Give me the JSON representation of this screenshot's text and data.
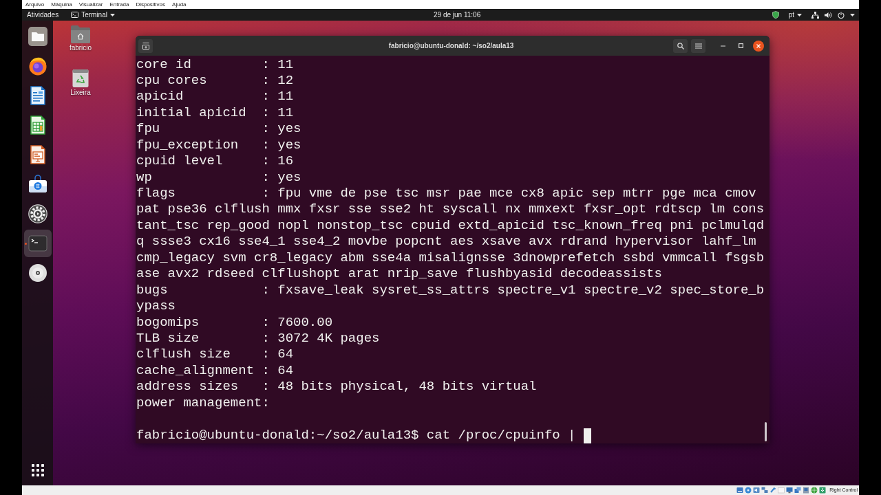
{
  "vm_menu": {
    "items": [
      "Arquivo",
      "Máquina",
      "Visualizar",
      "Entrada",
      "Dispositivos",
      "Ajuda"
    ]
  },
  "top_bar": {
    "activities": "Atividades",
    "app_menu": "Terminal",
    "clock": "29 de jun 11:06",
    "keyboard_layout": "pt"
  },
  "dock": {
    "items": [
      {
        "kind": "files",
        "selected": false,
        "running": false
      },
      {
        "kind": "browser",
        "selected": false,
        "running": false
      },
      {
        "kind": "writer",
        "selected": false,
        "running": false
      },
      {
        "kind": "spreadsheet",
        "selected": false,
        "running": false
      },
      {
        "kind": "presentation",
        "selected": false,
        "running": false
      },
      {
        "kind": "store",
        "selected": false,
        "running": false
      },
      {
        "kind": "settings",
        "selected": false,
        "running": false
      },
      {
        "kind": "terminal",
        "selected": true,
        "running": true
      },
      {
        "kind": "disc",
        "selected": false,
        "running": false
      }
    ]
  },
  "desktop_icons": [
    {
      "kind": "home",
      "label": "fabricio"
    },
    {
      "kind": "trash",
      "label": "Lixeira"
    }
  ],
  "terminal": {
    "title": "fabricio@ubuntu-donald: ~/so2/aula13",
    "lines": [
      "core id         : 11",
      "cpu cores       : 12",
      "apicid          : 11",
      "initial apicid  : 11",
      "fpu             : yes",
      "fpu_exception   : yes",
      "cpuid level     : 16",
      "wp              : yes",
      "flags           : fpu vme de pse tsc msr pae mce cx8 apic sep mtrr pge mca cmov",
      "pat pse36 clflush mmx fxsr sse sse2 ht syscall nx mmxext fxsr_opt rdtscp lm cons",
      "tant_tsc rep_good nopl nonstop_tsc cpuid extd_apicid tsc_known_freq pni pclmulqd",
      "q ssse3 cx16 sse4_1 sse4_2 movbe popcnt aes xsave avx rdrand hypervisor lahf_lm",
      "cmp_legacy svm cr8_legacy abm sse4a misalignsse 3dnowprefetch ssbd vmmcall fsgsb",
      "ase avx2 rdseed clflushopt arat nrip_save flushbyasid decodeassists",
      "bugs            : fxsave_leak sysret_ss_attrs spectre_v1 spectre_v2 spec_store_b",
      "ypass",
      "bogomips        : 7600.00",
      "TLB size        : 3072 4K pages",
      "clflush size    : 64",
      "cache_alignment : 64",
      "address sizes   : 48 bits physical, 48 bits virtual",
      "power management:"
    ],
    "prompt": {
      "text": "fabricio@ubuntu-donald:~/so2/aula13$ cat /proc/cpuinfo | ",
      "cursor": true
    }
  },
  "status_bar": {
    "host_key": "Right Control"
  }
}
